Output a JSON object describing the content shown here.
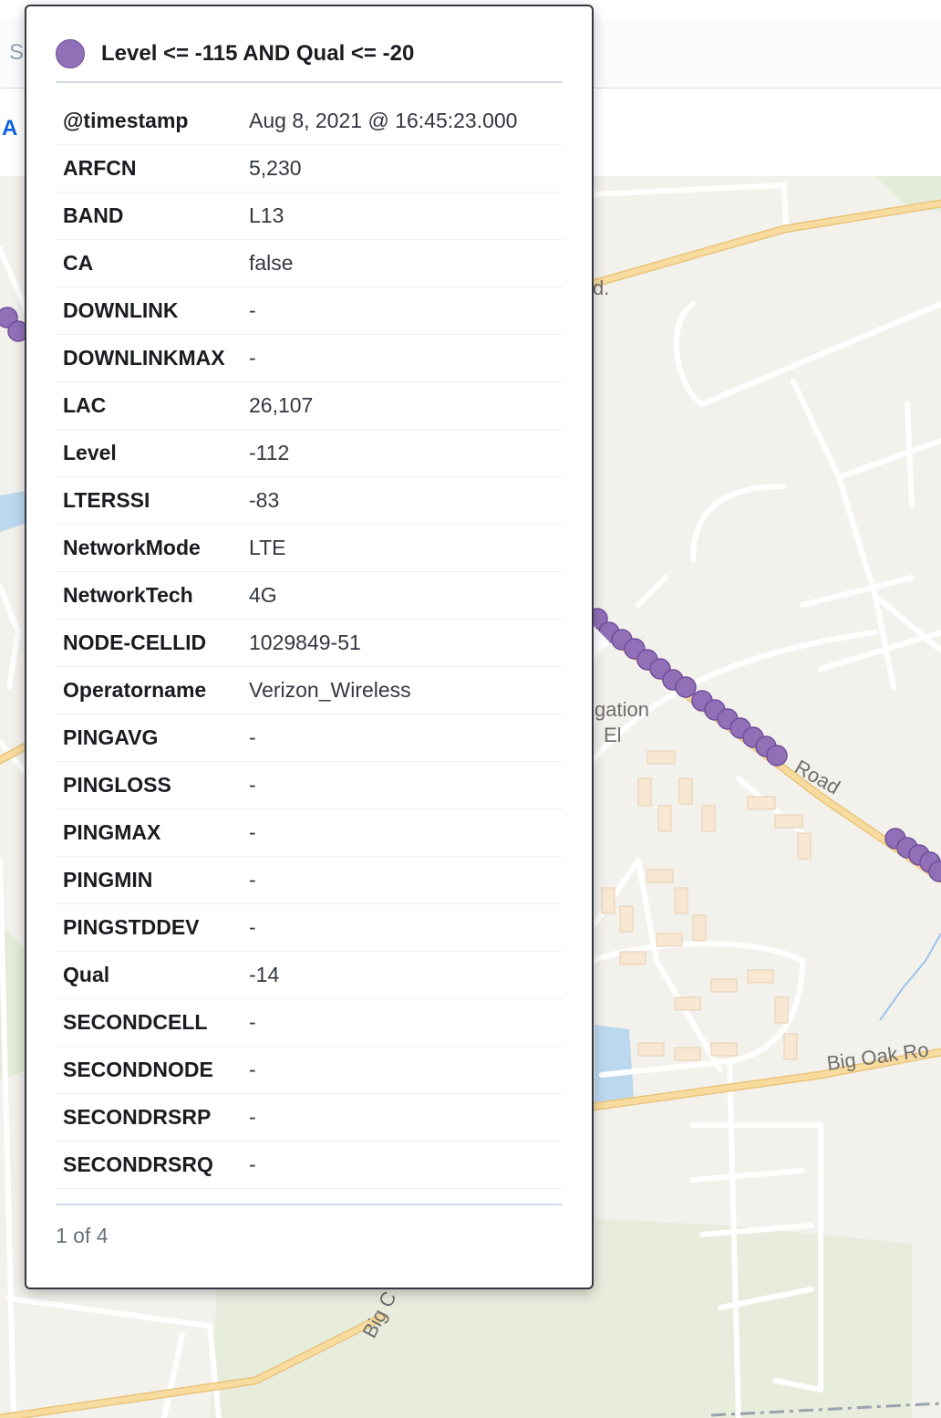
{
  "header": {
    "search_fragment": "S",
    "add_filter_fragment": "A"
  },
  "map": {
    "labels": {
      "road_d": "d.",
      "gation": "gation",
      "el": "El",
      "road": "Road",
      "big_oak": "Big Oak Ro",
      "big_c": "Big C"
    },
    "colors": {
      "land": "#f3f1ec",
      "major_road": "#f6d48d",
      "minor_road": "#ffffff",
      "water": "#bcd8ef",
      "park": "#e3ecd8",
      "dot": "#9170b8"
    }
  },
  "popover": {
    "layer_title": "Level <= -115 AND Qual <= -20",
    "layer_icon": "filled-circle-icon",
    "rows": [
      {
        "key": "@timestamp",
        "value": "Aug 8, 2021 @ 16:45:23.000"
      },
      {
        "key": "ARFCN",
        "value": "5,230"
      },
      {
        "key": "BAND",
        "value": "L13"
      },
      {
        "key": "CA",
        "value": "false"
      },
      {
        "key": "DOWNLINK",
        "value": "-"
      },
      {
        "key": "DOWNLINKMAX",
        "value": "-"
      },
      {
        "key": "LAC",
        "value": "26,107"
      },
      {
        "key": "Level",
        "value": "-112"
      },
      {
        "key": "LTERSSI",
        "value": "-83"
      },
      {
        "key": "NetworkMode",
        "value": "LTE"
      },
      {
        "key": "NetworkTech",
        "value": "4G"
      },
      {
        "key": "NODE-CELLID",
        "value": "1029849-51"
      },
      {
        "key": "Operatorname",
        "value": "Verizon_Wireless"
      },
      {
        "key": "PINGAVG",
        "value": "-"
      },
      {
        "key": "PINGLOSS",
        "value": "-"
      },
      {
        "key": "PINGMAX",
        "value": "-"
      },
      {
        "key": "PINGMIN",
        "value": "-"
      },
      {
        "key": "PINGSTDDEV",
        "value": "-"
      },
      {
        "key": "Qual",
        "value": "-14"
      },
      {
        "key": "SECONDCELL",
        "value": "-"
      },
      {
        "key": "SECONDNODE",
        "value": "-"
      },
      {
        "key": "SECONDRSRP",
        "value": "-"
      },
      {
        "key": "SECONDRSRQ",
        "value": "-"
      }
    ],
    "pagination": "1 of 4"
  }
}
